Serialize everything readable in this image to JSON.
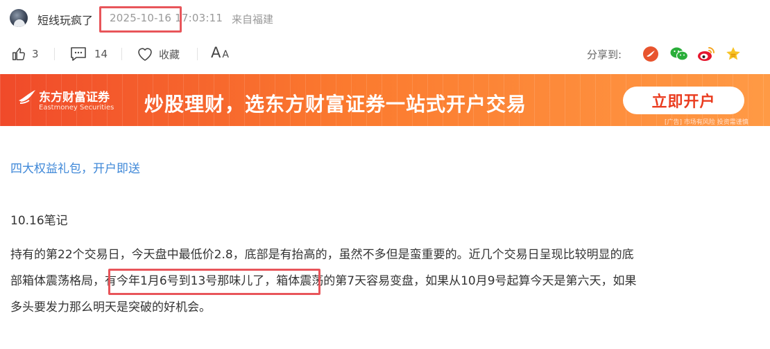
{
  "header": {
    "username": "短线玩疯了",
    "post_time": "2025-10-16 17:03:11",
    "source": "来自福建"
  },
  "actions": {
    "like_count": "3",
    "comment_count": "14",
    "favorite_label": "收藏",
    "font_large": "A",
    "font_small": "A",
    "share_label": "分享到:",
    "share_targets": [
      "dongfang-icon",
      "wechat-icon",
      "weibo-icon",
      "favorite-star-icon"
    ]
  },
  "banner": {
    "brand_cn": "东方财富证券",
    "brand_en": "Eastmoney Securities",
    "slogan": "炒股理财，选东方财富证券一站式开户交易",
    "button_label": "立即开户",
    "disclaimer": "[广告] 市场有风险 投资需谨慎"
  },
  "article": {
    "promo_link": "四大权益礼包，开户即送",
    "note_title": "10.16笔记",
    "lines": [
      "持有的第22个交易日，今天盘中最低价2.8，底部是有抬高的，虽然不多但是蛮重要的。近几个交易日呈现比较明显的底",
      "部箱体震荡格局，有今年1月6号到13号那味儿了，箱体震荡的第7天容易变盘，如果从10月9号起算今天是第六天，如果",
      "多头要发力那么明天是突破的好机会。"
    ]
  },
  "colors": {
    "link": "#3f88d8",
    "highlight_box": "#e8555a",
    "banner_start": "#f04a2a",
    "banner_end": "#ff9a45"
  }
}
